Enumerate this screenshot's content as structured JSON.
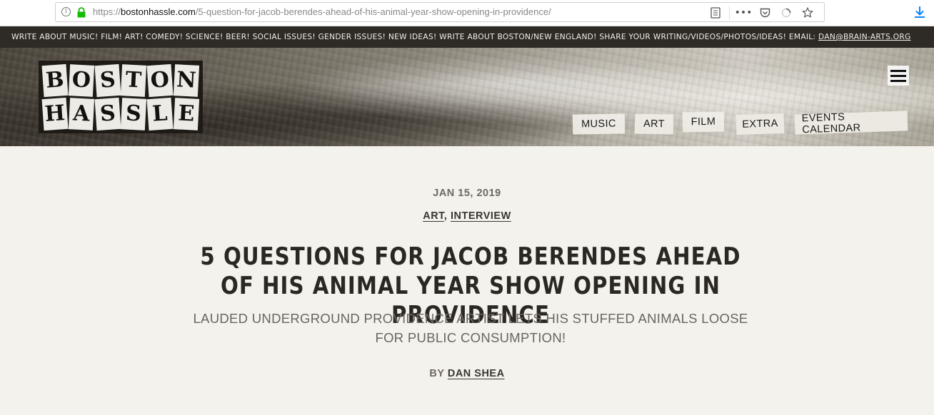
{
  "browser": {
    "url_prefix": "https://",
    "url_host": "bostonhassle.com",
    "url_path": "/5-question-for-jacob-berendes-ahead-of-his-animal-year-show-opening-in-providence/"
  },
  "announcement": {
    "text": "WRITE ABOUT MUSIC! FILM! ART! COMEDY! SCIENCE! BEER! SOCIAL ISSUES! GENDER ISSUES! NEW IDEAS! WRITE ABOUT BOSTON/NEW ENGLAND! SHARE YOUR WRITING/VIDEOS/PHOTOS/IDEAS! EMAIL: ",
    "email": "DAN@BRAIN-ARTS.ORG"
  },
  "logo": {
    "row1": [
      "B",
      "O",
      "S",
      "T",
      "O",
      "N"
    ],
    "row2": [
      "H",
      "A",
      "S",
      "S",
      "L",
      "E"
    ]
  },
  "nav": {
    "music": "MUSIC",
    "art": "ART",
    "film": "FILM",
    "extra": "EXTRA",
    "events": "EVENTS CALENDAR"
  },
  "article": {
    "date": "JAN 15, 2019",
    "categories": [
      "ART",
      "INTERVIEW"
    ],
    "category_separator": ", ",
    "title": "5 QUESTIONS FOR JACOB BERENDES AHEAD OF HIS ANIMAL YEAR SHOW OPENING IN PROVIDENCE",
    "subtitle": "LAUDED UNDERGROUND PROVIDENCE ARTIST LETS HIS STUFFED ANIMALS LOOSE FOR PUBLIC CONSUMPTION!",
    "byline_prefix": "BY ",
    "author": "DAN SHEA"
  },
  "colors": {
    "announce_bg": "#2e2a25",
    "page_bg": "#f4f2ed",
    "title_color": "#2b2824",
    "lock_green": "#12bc00",
    "download_blue": "#0a84ff"
  },
  "icons": [
    "info-icon",
    "lock-icon",
    "reader-view-icon",
    "more-actions-icon",
    "pocket-icon",
    "loading-icon",
    "bookmark-star-icon",
    "download-icon",
    "hamburger-menu-icon"
  ]
}
